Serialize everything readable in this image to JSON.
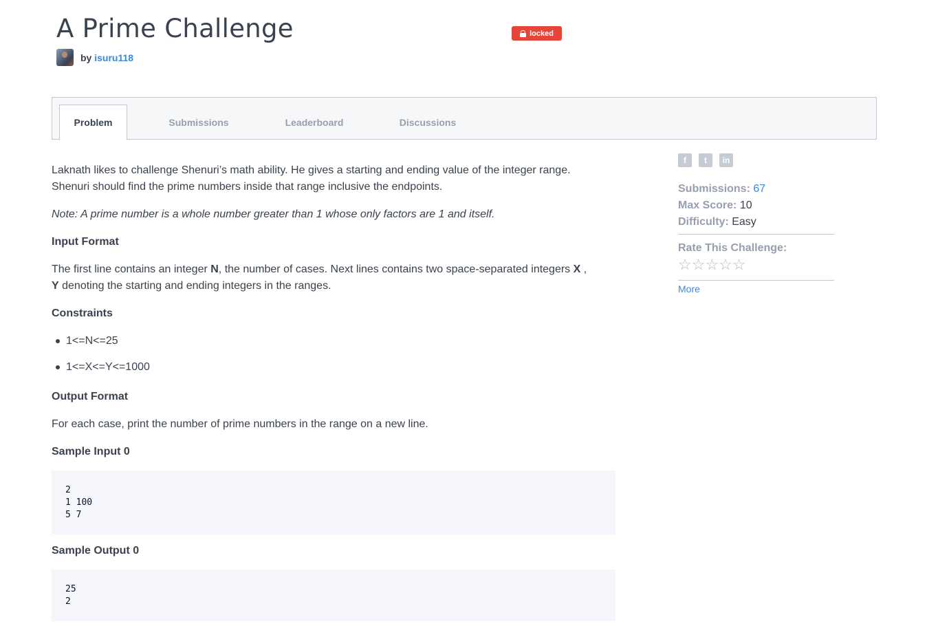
{
  "header": {
    "title": "A Prime Challenge",
    "badge": "locked",
    "by_label": "by",
    "author": "isuru118"
  },
  "tabs": [
    {
      "label": "Problem",
      "active": true
    },
    {
      "label": "Submissions",
      "active": false
    },
    {
      "label": "Leaderboard",
      "active": false
    },
    {
      "label": "Discussions",
      "active": false
    }
  ],
  "problem": {
    "intro_line1": "Laknath likes to challenge Shenuri’s math ability. He gives a starting and ending value of the integer range.",
    "intro_line2": "Shenuri should find the prime numbers inside that range inclusive the endpoints.",
    "note": "Note: A prime number is a whole number greater than 1 whose only factors are 1 and itself.",
    "input_heading": "Input Format",
    "input_text_a": "The first line contains an integer ",
    "input_N": "N",
    "input_text_b": ", the number of cases. Next lines contains two space-separated integers ",
    "input_X": "X",
    "input_text_c": " ,",
    "input_Y": "Y",
    "input_text_d": " denoting the starting and ending integers in the ranges.",
    "constraints_heading": "Constraints",
    "constraints": [
      "1<=N<=25",
      "1<=X<=Y<=1000"
    ],
    "output_heading": "Output Format",
    "output_text": "For each case, print the number of prime numbers in the range on a new line.",
    "sample_input_heading": "Sample Input 0",
    "sample_input": "2\n1 100\n5 7",
    "sample_output_heading": "Sample Output 0",
    "sample_output": "25\n2"
  },
  "sidebar": {
    "social_icons": [
      "facebook-icon",
      "twitter-icon",
      "linkedin-icon"
    ],
    "submissions_label": "Submissions:",
    "submissions_value": "67",
    "max_score_label": "Max Score:",
    "max_score_value": "10",
    "difficulty_label": "Difficulty:",
    "difficulty_value": "Easy",
    "rate_label": "Rate This Challenge:",
    "stars": "☆☆☆☆☆",
    "more_label": "More"
  },
  "colors": {
    "text": "#39424e",
    "muted": "#979faf",
    "link": "#3a88d8",
    "badge": "#e6463a",
    "code_bg": "#f4f6fb"
  }
}
